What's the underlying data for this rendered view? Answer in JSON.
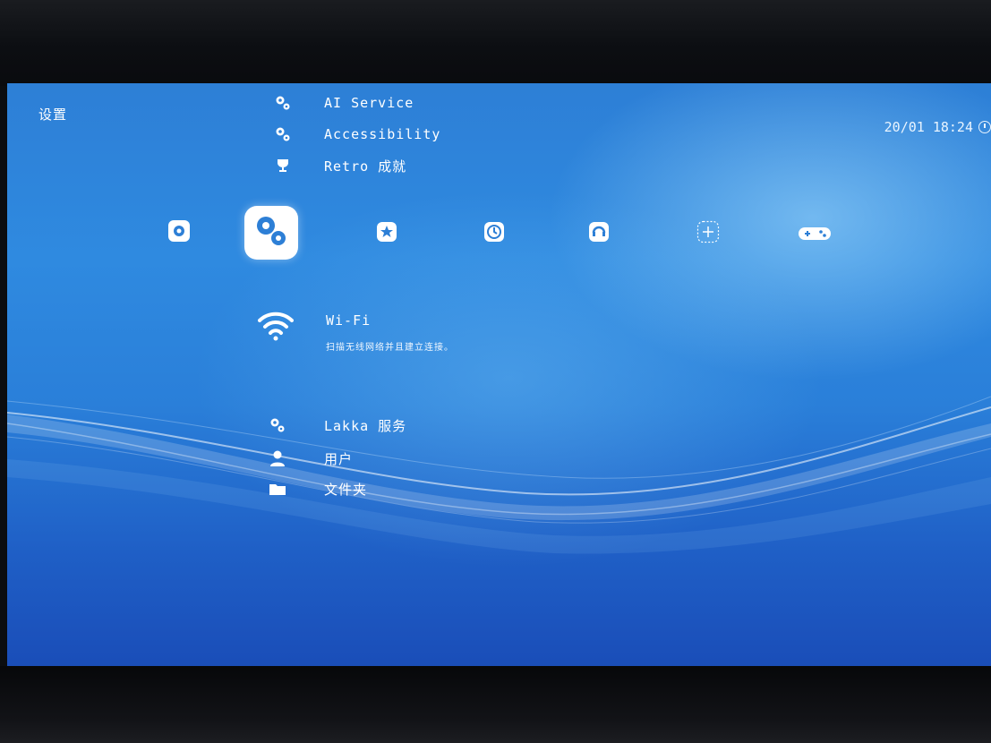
{
  "header": {
    "title": "设置",
    "clock": "20/01 18:24"
  },
  "top_menu": [
    {
      "label": "AI Service",
      "icon": "gears-icon"
    },
    {
      "label": "Accessibility",
      "icon": "gears-icon"
    },
    {
      "label": "Retro 成就",
      "icon": "trophy-icon"
    }
  ],
  "tabs": [
    {
      "name": "main-menu",
      "icon": "retroarch-icon"
    },
    {
      "name": "settings",
      "icon": "gears-icon",
      "selected": true
    },
    {
      "name": "favorites",
      "icon": "star-icon"
    },
    {
      "name": "history",
      "icon": "clock-icon"
    },
    {
      "name": "netplay",
      "icon": "netplay-icon"
    },
    {
      "name": "import-content",
      "icon": "plus-icon"
    },
    {
      "name": "explore",
      "icon": "gamepad-icon"
    }
  ],
  "selected_item": {
    "label": "Wi-Fi",
    "sublabel": "扫描无线网络并且建立连接。",
    "icon": "wifi-icon"
  },
  "bottom_menu": [
    {
      "label": "Lakka 服务",
      "icon": "gears-icon"
    },
    {
      "label": "用户",
      "icon": "user-icon"
    },
    {
      "label": "文件夹",
      "icon": "folder-icon"
    }
  ],
  "colors": {
    "background_top": "#2f8ae0",
    "background_bottom": "#1a4db8",
    "text": "#ffffff",
    "tab_highlight": "#ffffff"
  }
}
